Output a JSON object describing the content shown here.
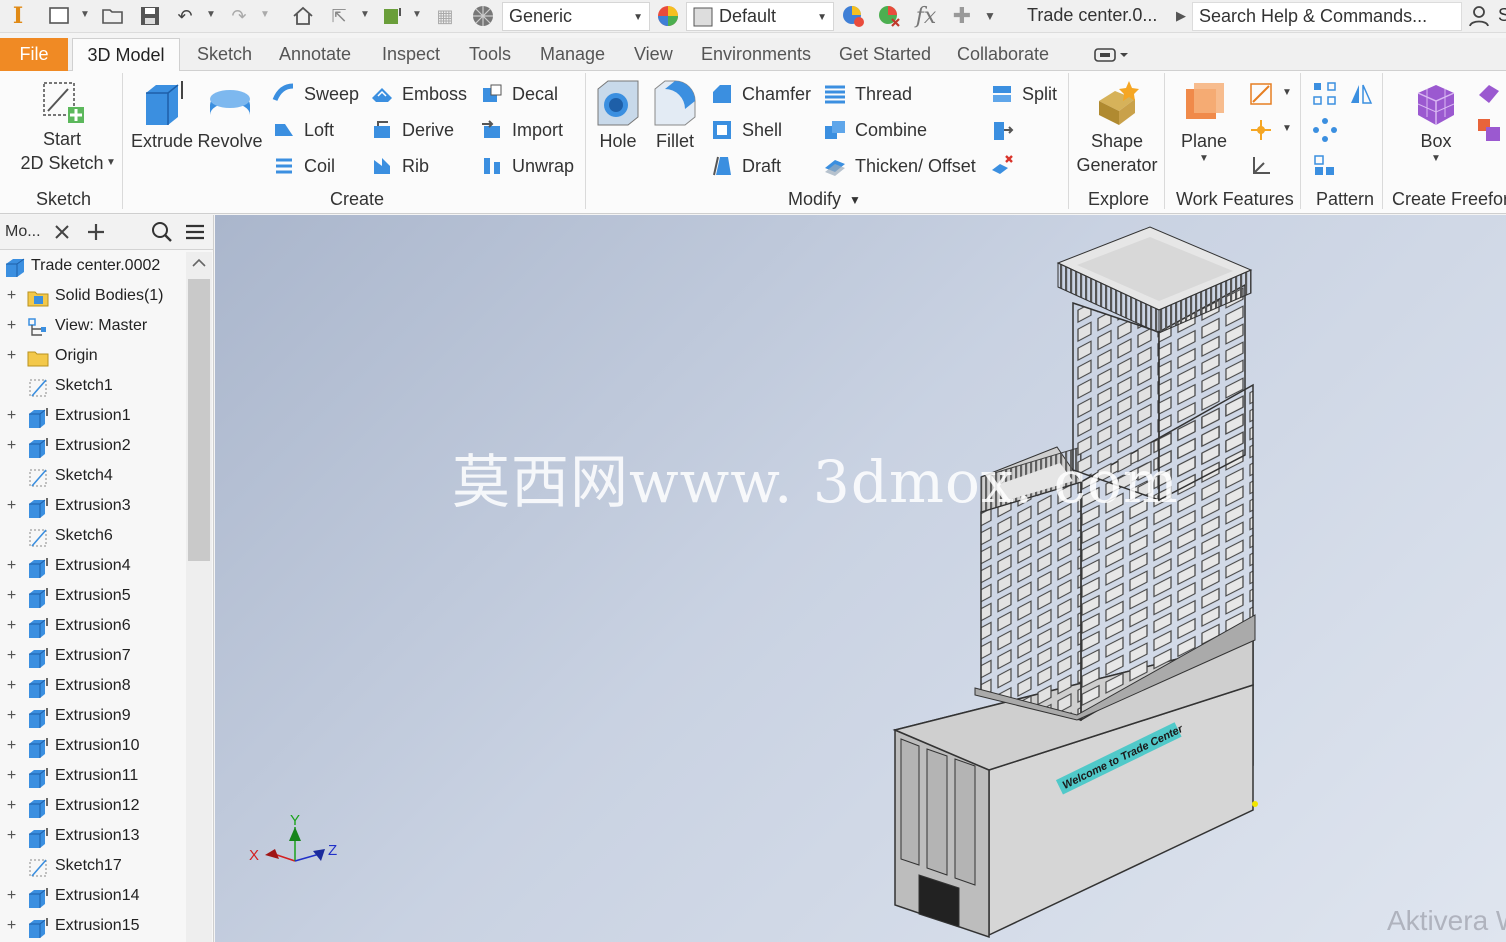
{
  "quick_access": {
    "material": "Generic",
    "appearance": "Default",
    "doc_title": "Trade center.0...",
    "search_placeholder": "Search Help & Commands...",
    "partial_right": "S"
  },
  "tabs": [
    "File",
    "3D Model",
    "Sketch",
    "Annotate",
    "Inspect",
    "Tools",
    "Manage",
    "View",
    "Environments",
    "Get Started",
    "Collaborate"
  ],
  "ribbon": {
    "sketch_panel": {
      "start_line1": "Start",
      "start_line2": "2D Sketch",
      "title": "Sketch"
    },
    "create_panel": {
      "extrude": "Extrude",
      "revolve": "Revolve",
      "sweep": "Sweep",
      "loft": "Loft",
      "coil": "Coil",
      "emboss": "Emboss",
      "derive": "Derive",
      "rib": "Rib",
      "decal": "Decal",
      "import": "Import",
      "unwrap": "Unwrap",
      "title": "Create"
    },
    "modify_panel": {
      "hole": "Hole",
      "fillet": "Fillet",
      "chamfer": "Chamfer",
      "shell": "Shell",
      "draft": "Draft",
      "thread": "Thread",
      "combine": "Combine",
      "thicken": "Thicken/ Offset",
      "split": "Split",
      "title": "Modify"
    },
    "explore_panel": {
      "line1": "Shape",
      "line2": "Generator",
      "title": "Explore"
    },
    "work_panel": {
      "plane": "Plane",
      "title": "Work Features"
    },
    "pattern_panel": {
      "title": "Pattern"
    },
    "freeform_panel": {
      "box": "Box",
      "title": "Create Freefor"
    }
  },
  "browser": {
    "title": "Mo...",
    "items": [
      {
        "label": "Trade center.0002",
        "icon": "part-icon",
        "expand": false,
        "root": true
      },
      {
        "label": "Solid Bodies(1)",
        "icon": "folder-solid-icon",
        "expand": true
      },
      {
        "label": "View: Master",
        "icon": "view-icon",
        "expand": true
      },
      {
        "label": "Origin",
        "icon": "folder-icon",
        "expand": true
      },
      {
        "label": "Sketch1",
        "icon": "sketch-icon",
        "expand": false
      },
      {
        "label": "Extrusion1",
        "icon": "extrusion-icon",
        "expand": true
      },
      {
        "label": "Extrusion2",
        "icon": "extrusion-icon",
        "expand": true
      },
      {
        "label": "Sketch4",
        "icon": "sketch-icon",
        "expand": false
      },
      {
        "label": "Extrusion3",
        "icon": "extrusion-icon",
        "expand": true
      },
      {
        "label": "Sketch6",
        "icon": "sketch-icon",
        "expand": false
      },
      {
        "label": "Extrusion4",
        "icon": "extrusion-icon",
        "expand": true
      },
      {
        "label": "Extrusion5",
        "icon": "extrusion-icon",
        "expand": true
      },
      {
        "label": "Extrusion6",
        "icon": "extrusion-icon",
        "expand": true
      },
      {
        "label": "Extrusion7",
        "icon": "extrusion-icon",
        "expand": true
      },
      {
        "label": "Extrusion8",
        "icon": "extrusion-icon",
        "expand": true
      },
      {
        "label": "Extrusion9",
        "icon": "extrusion-icon",
        "expand": true
      },
      {
        "label": "Extrusion10",
        "icon": "extrusion-icon",
        "expand": true
      },
      {
        "label": "Extrusion11",
        "icon": "extrusion-icon",
        "expand": true
      },
      {
        "label": "Extrusion12",
        "icon": "extrusion-icon",
        "expand": true
      },
      {
        "label": "Extrusion13",
        "icon": "extrusion-icon",
        "expand": true
      },
      {
        "label": "Sketch17",
        "icon": "sketch-icon",
        "expand": false
      },
      {
        "label": "Extrusion14",
        "icon": "extrusion-icon",
        "expand": true
      },
      {
        "label": "Extrusion15",
        "icon": "extrusion-icon",
        "expand": true
      }
    ]
  },
  "viewport": {
    "watermark": "莫西网www. 3dmox. com",
    "sign_text": "Welcome to Trade Center",
    "axis_x": "X",
    "axis_y": "Y",
    "axis_z": "Z",
    "activate_text": "Aktivera W"
  },
  "colors": {
    "file_tab": "#f08a24",
    "accent_blue": "#2f7fd6",
    "part_blue": "#3b8fe0"
  }
}
